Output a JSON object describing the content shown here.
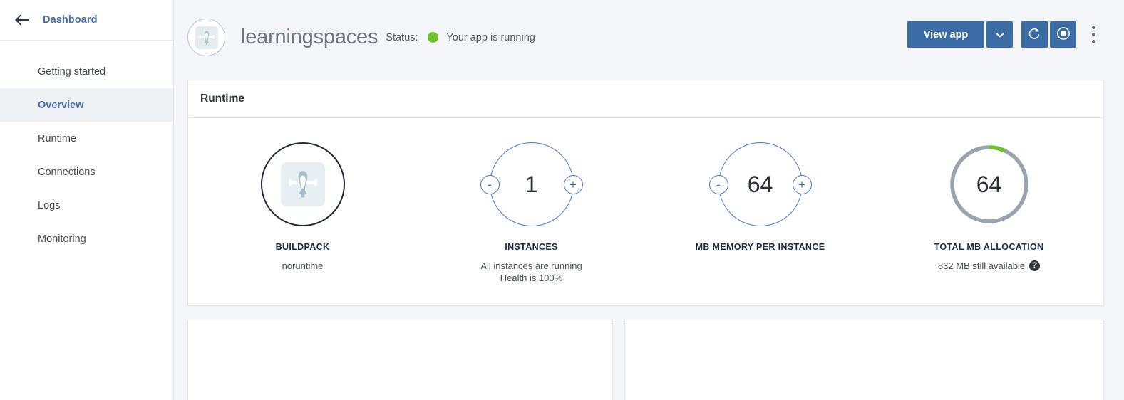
{
  "sidebar": {
    "back_icon": "arrow-left-icon",
    "title": "Dashboard",
    "items": [
      {
        "label": "Getting started",
        "active": false
      },
      {
        "label": "Overview",
        "active": true
      },
      {
        "label": "Runtime",
        "active": false
      },
      {
        "label": "Connections",
        "active": false
      },
      {
        "label": "Logs",
        "active": false
      },
      {
        "label": "Monitoring",
        "active": false
      }
    ]
  },
  "header": {
    "avatar_icon": "app-logo-icon",
    "app_name": "learningspaces",
    "status_label": "Status:",
    "status_dot_color": "#6fc02a",
    "status_text": "Your app is running",
    "actions": {
      "view_app_label": "View app",
      "caret_icon": "chevron-down-icon",
      "restart_icon": "restart-icon",
      "stop_icon": "stop-icon",
      "overflow_icon": "more-vertical-icon"
    }
  },
  "runtime_card": {
    "title": "Runtime",
    "metrics": [
      {
        "id": "buildpack",
        "title": "BUILDPACK",
        "icon": "buildpack-logo-icon",
        "sub1": "noruntime",
        "sub2": "",
        "ring_color": "#1e2a35"
      },
      {
        "id": "instances",
        "title": "INSTANCES",
        "value": "1",
        "minus_label": "-",
        "plus_label": "+",
        "sub1": "All instances are running",
        "sub2": "Health is 100%",
        "ring_color": "#4a7bbd"
      },
      {
        "id": "memory-per-instance",
        "title": "MB MEMORY PER INSTANCE",
        "value": "64",
        "minus_label": "-",
        "plus_label": "+",
        "sub1": "",
        "sub2": "",
        "ring_color": "#4a7bbd"
      },
      {
        "id": "total-allocation",
        "title": "TOTAL MB ALLOCATION",
        "value": "64",
        "sub1": "832 MB still available",
        "help_icon": "help-icon",
        "ring_color": "#9aa4ae",
        "progress_color": "#6fc02a",
        "progress_percent": 7
      }
    ]
  }
}
